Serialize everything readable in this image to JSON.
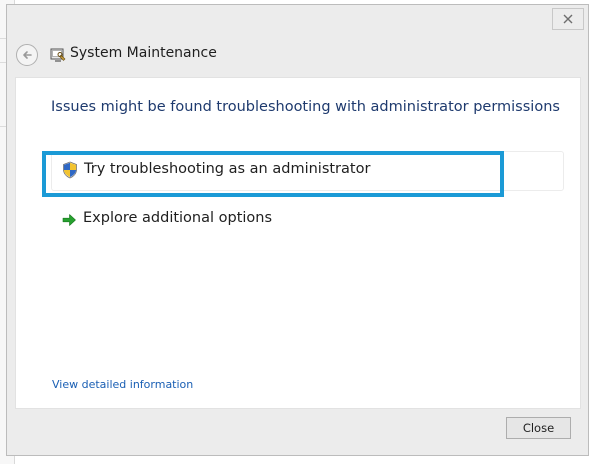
{
  "window": {
    "title": "System Maintenance",
    "icon": "system-maintenance-icon",
    "close_icon": "close-icon",
    "back_icon": "back-arrow-icon"
  },
  "content": {
    "heading": "Issues might be found troubleshooting with administrator permissions",
    "options": [
      {
        "label": "Try troubleshooting as an administrator",
        "icon": "shield-icon",
        "highlighted": true
      },
      {
        "label": "Explore additional options",
        "icon": "green-arrow-icon",
        "highlighted": false
      }
    ],
    "detail_link": "View detailed information"
  },
  "footer": {
    "close_label": "Close"
  },
  "colors": {
    "heading": "#1e3a6e",
    "link": "#1a5fb4",
    "highlight": "#1b9ad6",
    "arrow": "#27a12f"
  }
}
